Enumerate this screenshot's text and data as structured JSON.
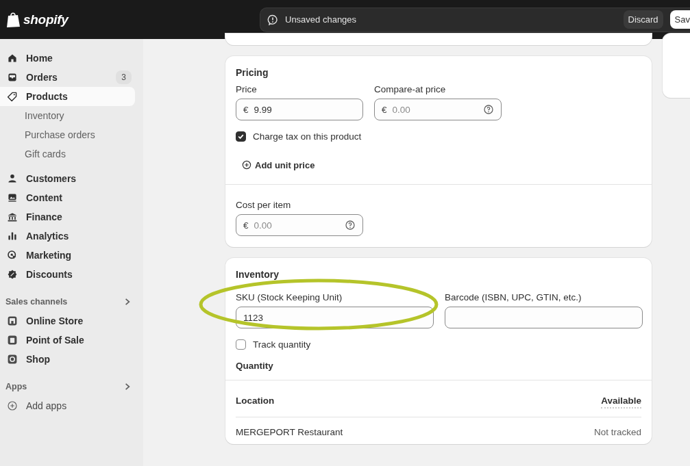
{
  "top_bar": {
    "logo": "shopify",
    "message": "Unsaved changes",
    "buttons": [
      {
        "label": "Discard",
        "kind": "secondary"
      },
      {
        "label": "Sav",
        "kind": "primary"
      }
    ]
  },
  "sidebar": {
    "items": [
      {
        "label": "Home",
        "selected": false
      },
      {
        "label": "Orders",
        "badge": "3",
        "selected": false
      },
      {
        "label": "Products",
        "selected": true,
        "children": [
          {
            "label": "Inventory",
            "selected": false
          },
          {
            "label": "Purchase orders",
            "selected": false
          },
          {
            "label": "Gift cards",
            "selected": false
          }
        ]
      },
      {
        "label": "Customers",
        "selected": false
      },
      {
        "label": "Content",
        "selected": false
      },
      {
        "label": "Finance",
        "selected": false
      },
      {
        "label": "Analytics",
        "selected": false
      },
      {
        "label": "Marketing",
        "selected": false
      },
      {
        "label": "Discounts",
        "selected": false
      }
    ],
    "sections": [
      {
        "title": "Sales channels",
        "items": [
          {
            "label": "Online Store",
            "selected": false
          },
          {
            "label": "Point of Sale",
            "selected": false
          },
          {
            "label": "Shop",
            "selected": false
          }
        ]
      },
      {
        "title": "Apps",
        "items": [
          {
            "label": "Add apps",
            "selected": false
          }
        ]
      }
    ]
  },
  "pricing": {
    "title": "Pricing",
    "fields": [
      {
        "label": "Price",
        "prefix": "€",
        "value": "9.99",
        "help": false
      },
      {
        "label": "Compare-at price",
        "prefix": "€",
        "placeholder": "0.00",
        "help": true
      }
    ],
    "charge_tax": {
      "label": "Charge tax on this product",
      "checked": true
    },
    "add_unit_price": "Add unit price",
    "cost": {
      "label": "Cost per item",
      "prefix": "€",
      "placeholder": "0.00",
      "help": true
    }
  },
  "inventory": {
    "title": "Inventory",
    "fields": [
      {
        "label": "SKU (Stock Keeping Unit)",
        "value": "1123",
        "highlighted": true
      },
      {
        "label": "Barcode (ISBN, UPC, GTIN, etc.)",
        "highlighted": false
      }
    ],
    "track_quantity": {
      "label": "Track quantity",
      "checked": false
    },
    "quantity_title": "Quantity",
    "columns": [
      "Location",
      "Available"
    ],
    "rows": [
      {
        "location": "MERGEPORT Restaurant",
        "available": "Not tracked"
      }
    ]
  }
}
